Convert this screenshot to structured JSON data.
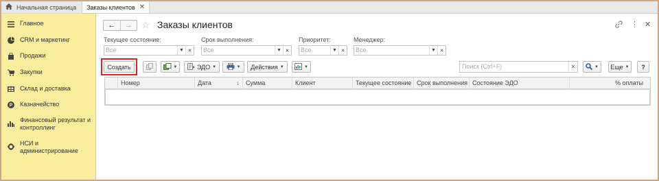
{
  "tabs": {
    "home": {
      "label": "Начальная страница",
      "icon": "home-icon"
    },
    "active": {
      "label": "Заказы клиентов",
      "close": "✕"
    }
  },
  "sidebar": {
    "items": [
      {
        "label": "Главное",
        "icon": "menu-icon"
      },
      {
        "label": "CRM и маркетинг",
        "icon": "pie-chart-icon"
      },
      {
        "label": "Продажи",
        "icon": "bag-icon"
      },
      {
        "label": "Закупки",
        "icon": "cart-icon"
      },
      {
        "label": "Склад и доставка",
        "icon": "warehouse-icon"
      },
      {
        "label": "Казначейство",
        "icon": "coin-icon"
      },
      {
        "label": "Финансовый результат и контроллинг",
        "icon": "bar-chart-icon"
      },
      {
        "label": "НСИ и администрирование",
        "icon": "gear-icon"
      }
    ]
  },
  "header": {
    "title": "Заказы клиентов"
  },
  "filters": {
    "state": {
      "label": "Текущее состояние:",
      "placeholder": "Все"
    },
    "deadline": {
      "label": "Срок выполнения:",
      "placeholder": "Все"
    },
    "priority": {
      "label": "Приоритет:",
      "placeholder": "Все"
    },
    "manager": {
      "label": "Менеджер:",
      "placeholder": "Все"
    }
  },
  "toolbar": {
    "create": "Создать",
    "edo": "ЭДО",
    "actions": "Действия",
    "search_placeholder": "Поиск (Ctrl+F)",
    "more": "Еще",
    "help": "?"
  },
  "table": {
    "columns": [
      "Номер",
      "Дата",
      "Сумма",
      "Клиент",
      "Текущее состояние",
      "Срок выполнения",
      "Состояние ЭДО",
      "% оплаты"
    ],
    "rows": []
  },
  "colors": {
    "sidebar_bg": "#fbed9e",
    "highlight": "#e3221c",
    "frame": "#c9a88a"
  }
}
